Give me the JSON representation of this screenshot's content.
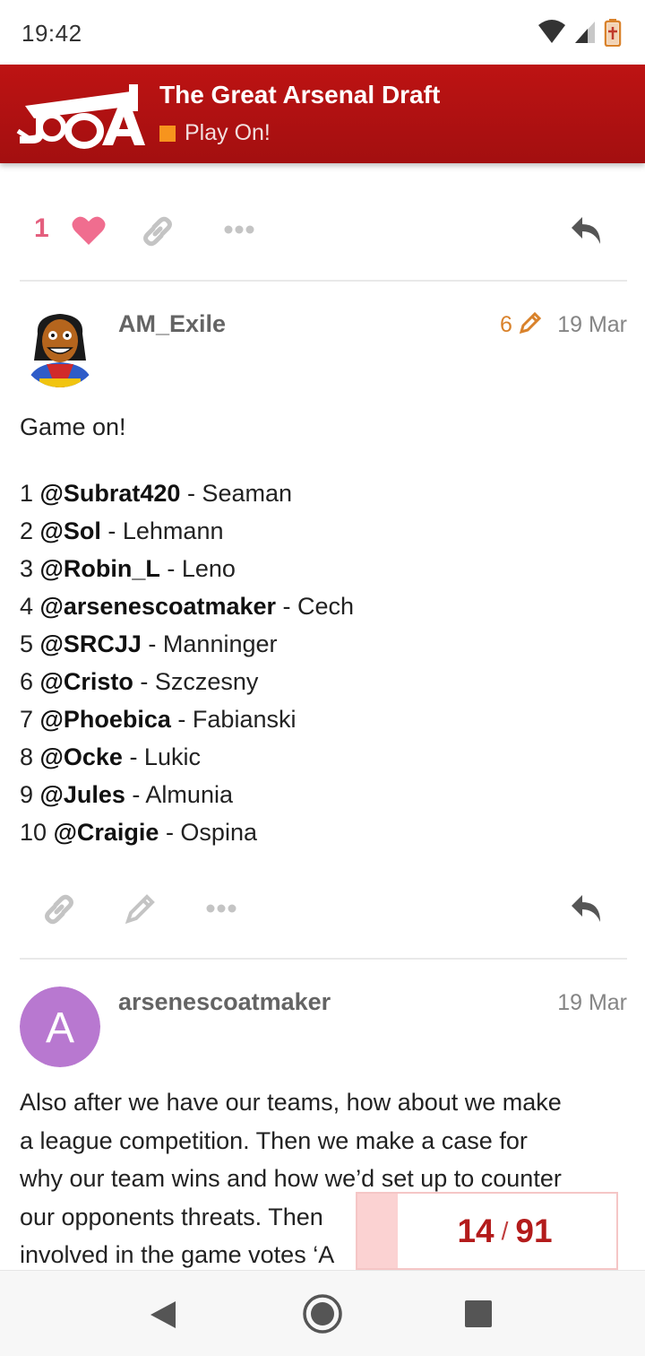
{
  "status_bar": {
    "time": "19:42",
    "icons": [
      "wifi-icon",
      "signal-icon",
      "battery-icon"
    ]
  },
  "header": {
    "logo_text": "JOA",
    "title": "The Great Arsenal Draft",
    "category": "Play On!",
    "category_color": "#f7941d",
    "brand_color": "#b51212"
  },
  "top_actions": {
    "like_count": "1",
    "icons": [
      "heart-icon",
      "link-icon",
      "more-icon",
      "reply-icon"
    ]
  },
  "posts": [
    {
      "username": "AM_Exile",
      "edit_count": "6",
      "date": "19 Mar",
      "intro": "Game on!",
      "picks": [
        {
          "num": "1",
          "user": "@Subrat420",
          "player": " - Seaman"
        },
        {
          "num": "2",
          "user": "@Sol",
          "player": " - Lehmann"
        },
        {
          "num": "3",
          "user": "@Robin_L",
          "player": " - Leno"
        },
        {
          "num": "4",
          "user": "@arsenescoatmaker",
          "player": " - Cech"
        },
        {
          "num": "5",
          "user": "@SRCJJ",
          "player": " - Manninger"
        },
        {
          "num": "6",
          "user": "@Cristo",
          "player": " - Szczesny"
        },
        {
          "num": "7",
          "user": "@Phoebica",
          "player": " - Fabianski"
        },
        {
          "num": "8",
          "user": "@Ocke",
          "player": " - Lukic"
        },
        {
          "num": "9",
          "user": "@Jules",
          "player": " - Almunia"
        },
        {
          "num": "10",
          "user": "@Craigie",
          "player": " - Ospina"
        }
      ]
    },
    {
      "username": "arsenescoatmaker",
      "avatar_letter": "A",
      "avatar_color": "#b878d0",
      "date": "19 Mar",
      "lines": [
        "Also after we have our teams, how about we make",
        "a league competition. Then we make a case for",
        "why our team wins and how we’d set up to counter",
        "our opponents threats. Then",
        "involved in the game votes ‘A"
      ]
    }
  ],
  "timeline": {
    "current": "14",
    "separator": "/",
    "total": "91",
    "progress": 0.154
  },
  "nav_bar": {
    "icons": [
      "back-icon",
      "home-icon",
      "recents-icon"
    ]
  }
}
